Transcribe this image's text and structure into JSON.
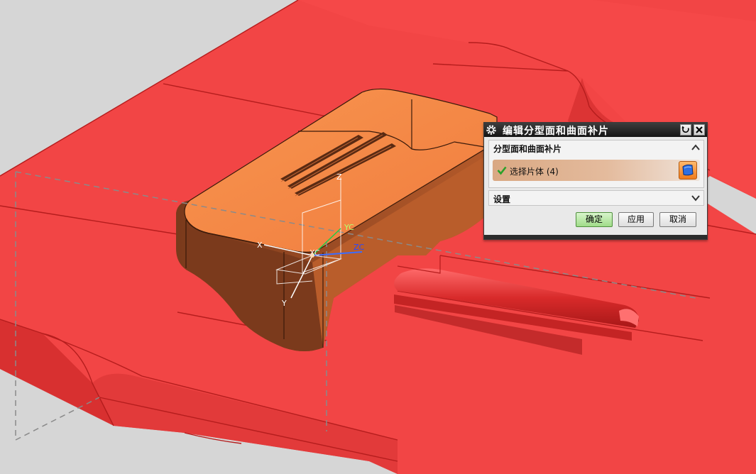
{
  "viewport": {
    "triad": {
      "x_label": "X",
      "y_label": "Y",
      "z_label": "Z",
      "xc_label": "XC",
      "yc_label": "YC",
      "zc_label": "ZC"
    }
  },
  "dialog": {
    "title": "编辑分型面和曲面补片",
    "group_main": {
      "label": "分型面和曲面补片"
    },
    "select_row": {
      "label": "选择片体",
      "count": "(4)"
    },
    "group_settings": {
      "label": "设置"
    },
    "buttons": {
      "ok": "确定",
      "apply": "应用",
      "cancel": "取消"
    },
    "icons": {
      "settings": "gear-icon",
      "reset": "reset-icon",
      "close": "close-icon",
      "collapse": "chevron-up-icon",
      "expand": "chevron-down-icon",
      "check": "check-icon",
      "face_select": "face-select-icon"
    }
  },
  "colors": {
    "background": "#d6d6d6",
    "parting_surface": "#f04343",
    "part_top": "#f48a4c",
    "part_side": "#a8522a",
    "select_check": "#2aa02a",
    "ok_button": "#9fdc88"
  }
}
